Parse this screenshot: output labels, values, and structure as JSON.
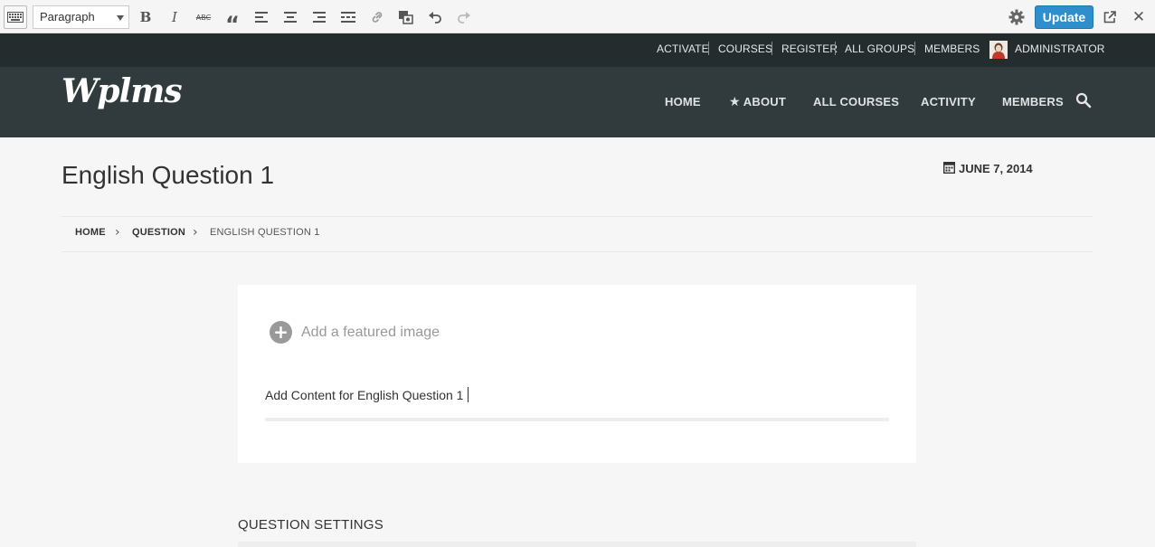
{
  "toolbar": {
    "format_value": "Paragraph",
    "update_label": "Update"
  },
  "admin_bar": {
    "links": [
      "ACTIVATE",
      "COURSES",
      "REGISTER",
      "ALL GROUPS",
      "MEMBERS"
    ],
    "user": "ADMINISTRATOR"
  },
  "header": {
    "logo": "Wplms",
    "nav": [
      "HOME",
      "ABOUT",
      "ALL COURSES",
      "ACTIVITY",
      "MEMBERS"
    ],
    "about_star": "★"
  },
  "page": {
    "title": "English Question 1",
    "date": "JUNE 7, 2014"
  },
  "breadcrumb": [
    "HOME",
    "QUESTION",
    "ENGLISH QUESTION 1"
  ],
  "editor": {
    "featured_label": "Add a featured image",
    "content": "Add Content for English Question 1",
    "plus_glyph": "+"
  },
  "settings_title": "QUESTION SETTINGS",
  "colors": {
    "accent": "#2e8fcc",
    "topbar": "#242c2d",
    "header": "#313b3d"
  }
}
